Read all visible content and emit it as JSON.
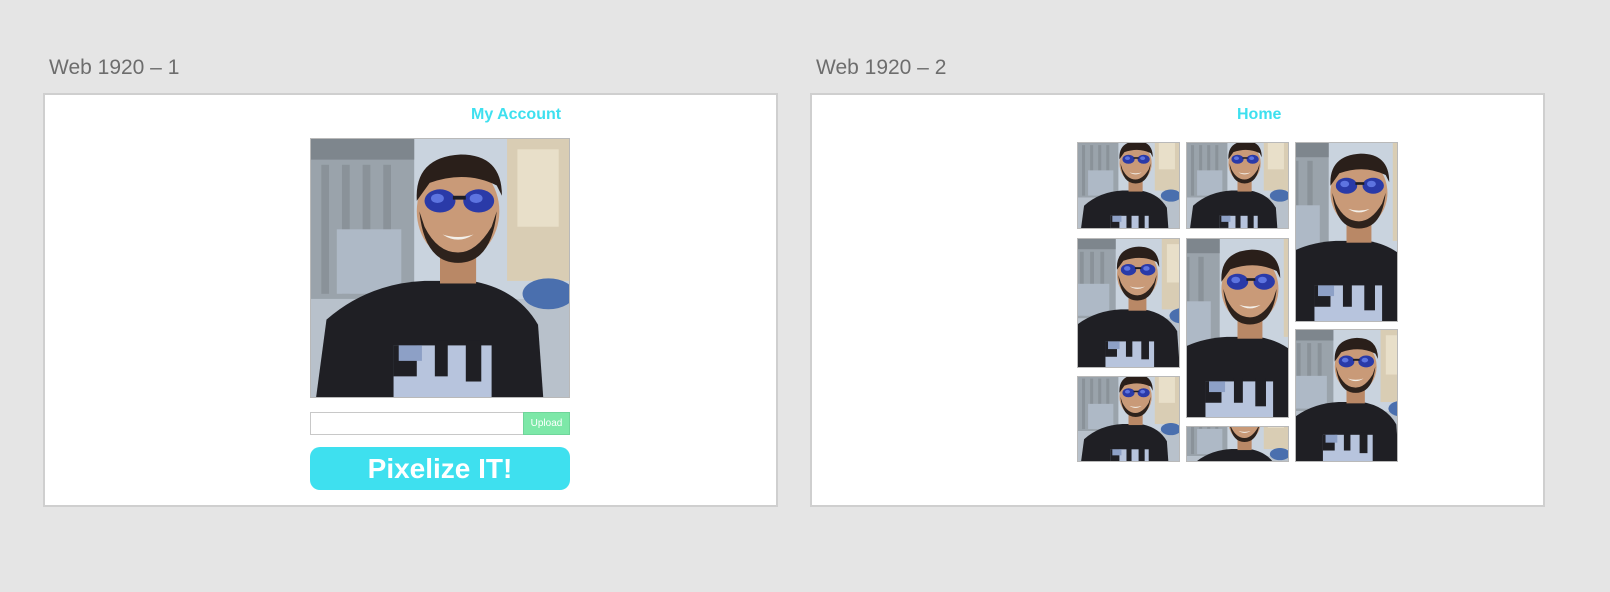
{
  "artboards": [
    {
      "label": "Web 1920 – 1",
      "page_title": "My Account"
    },
    {
      "label": "Web 1920 – 2",
      "page_title": "Home"
    }
  ],
  "account": {
    "file_input_value": "",
    "upload_label": "Upload",
    "pixelize_label": "Pixelize IT!"
  },
  "colors": {
    "canvas_background": "#e5e5e5",
    "accent_cyan": "#3ee0ef",
    "upload_green": "#7de8a8"
  },
  "gallery": {
    "photo_count": 8,
    "subject": "profile-photo"
  }
}
